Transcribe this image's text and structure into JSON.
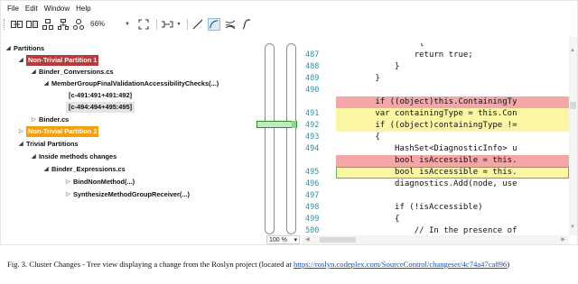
{
  "menu": [
    "File",
    "Edit",
    "Window",
    "Help"
  ],
  "toolbar": {
    "zoom": "66%",
    "icons": [
      "merge-icon",
      "compare-icon",
      "group-icon",
      "hierarchy-icon",
      "tree-icon",
      "fit-icon",
      "layout-icon",
      "line-icon",
      "curve-icon",
      "bundle-icon",
      "spline-icon"
    ]
  },
  "tree": {
    "partitions": "Partitions",
    "p1": "Non-Trivial Partition 1",
    "file1": "Binder_Conversions.cs",
    "method1": "MemberGroupFinalValidationAccessibilityChecks(...)",
    "chg1": "[c-491:491+491:492]",
    "chg2": "[c-494:494+495:495]",
    "file2": "Binder.cs",
    "p2": "Non-Trivial Partition 2",
    "trivial": "Trivial Partitions",
    "inside": "Inside methods changes",
    "file3": "Binder_Expressions.cs",
    "m2": "BindNonMethod(...)",
    "m3": "SynthesizeMethodGroupReceiver(...)"
  },
  "zoom_box": {
    "value": "100 %",
    "arrow": "▾"
  },
  "code": {
    "lines": [
      {
        "no": "",
        "text": "                 {",
        "cls": ""
      },
      {
        "no": "487",
        "text": "                return true;",
        "cls": ""
      },
      {
        "no": "488",
        "text": "            }",
        "cls": ""
      },
      {
        "no": "489",
        "text": "        }",
        "cls": ""
      },
      {
        "no": "490",
        "text": "",
        "cls": ""
      },
      {
        "no": "",
        "text": "        if ((object)this.ContainingTy",
        "cls": "red"
      },
      {
        "no": "491",
        "text": "        var containingType = this.Con",
        "cls": "yellow"
      },
      {
        "no": "492",
        "text": "        if ((object)containingType !=",
        "cls": "yellow"
      },
      {
        "no": "493",
        "text": "        {",
        "cls": ""
      },
      {
        "no": "494",
        "text": "            HashSet<DiagnosticInfo> u",
        "cls": ""
      },
      {
        "no": "",
        "text": "            bool isAccessible = this.",
        "cls": "red"
      },
      {
        "no": "495",
        "text": "            bool isAccessible = this.",
        "cls": "yellowbox"
      },
      {
        "no": "496",
        "text": "            diagnostics.Add(node, use",
        "cls": ""
      },
      {
        "no": "497",
        "text": "",
        "cls": ""
      },
      {
        "no": "498",
        "text": "            if (!isAccessible)",
        "cls": ""
      },
      {
        "no": "499",
        "text": "            {",
        "cls": ""
      },
      {
        "no": "500",
        "text": "                // In the presence of",
        "cls": ""
      }
    ]
  },
  "caption": {
    "prefix": "Fig. 3.  Cluster Changes - Tree view displaying a change from the Roslyn project (located at ",
    "link": "https://roslyn.codeplex.com/SourceControl/changeset/4c74a47ca896",
    "suffix": ")"
  },
  "colors": {
    "partition1": "#b93a3c",
    "partition2": "#f5a00a",
    "removed": "#f4a7a9",
    "modified": "#fbf6a4",
    "selection": "#63b34b",
    "line_number": "#2b91af"
  }
}
